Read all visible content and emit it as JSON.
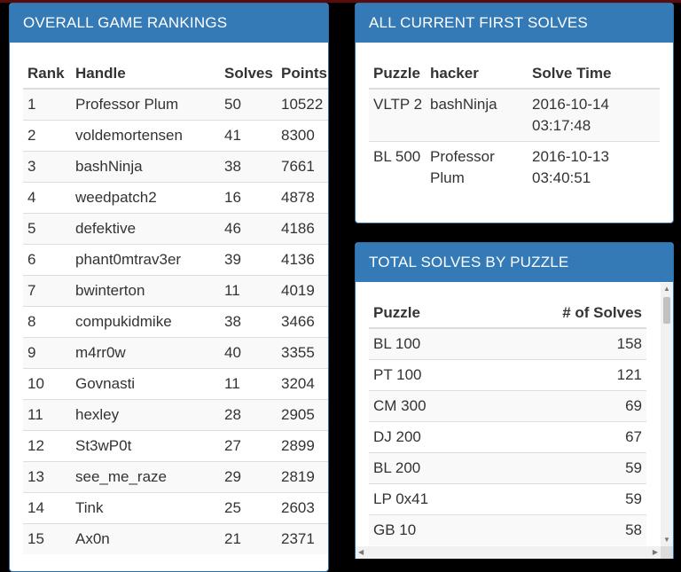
{
  "rankings": {
    "title": "OVERALL GAME RANKINGS",
    "headers": [
      "Rank",
      "Handle",
      "Solves",
      "Points"
    ],
    "rows": [
      [
        "1",
        "Professor Plum",
        "50",
        "10522"
      ],
      [
        "2",
        "voldemortensen",
        "41",
        "8300"
      ],
      [
        "3",
        "bashNinja",
        "38",
        "7661"
      ],
      [
        "4",
        "weedpatch2",
        "16",
        "4878"
      ],
      [
        "5",
        "defektive",
        "46",
        "4186"
      ],
      [
        "6",
        "phant0mtrav3er",
        "39",
        "4136"
      ],
      [
        "7",
        "bwinterton",
        "11",
        "4019"
      ],
      [
        "8",
        "compukidmike",
        "38",
        "3466"
      ],
      [
        "9",
        "m4rr0w",
        "40",
        "3355"
      ],
      [
        "10",
        "Govnasti",
        "11",
        "3204"
      ],
      [
        "11",
        "hexley",
        "28",
        "2905"
      ],
      [
        "12",
        "St3wP0t",
        "27",
        "2899"
      ],
      [
        "13",
        "see_me_raze",
        "29",
        "2819"
      ],
      [
        "14",
        "Tink",
        "25",
        "2603"
      ],
      [
        "15",
        "Ax0n",
        "21",
        "2371"
      ]
    ]
  },
  "first_solves": {
    "title": "ALL CURRENT FIRST SOLVES",
    "headers": [
      "Puzzle",
      "hacker",
      "Solve Time"
    ],
    "rows": [
      [
        "VLTP 2",
        "bashNinja",
        "2016-10-14 03:17:48"
      ],
      [
        "BL 500",
        "Professor Plum",
        "2016-10-13 03:40:51"
      ]
    ]
  },
  "total_solves": {
    "title": "TOTAL SOLVES BY PUZZLE",
    "headers": [
      "Puzzle",
      "# of Solves"
    ],
    "rows": [
      [
        "BL 100",
        "158"
      ],
      [
        "PT 100",
        "121"
      ],
      [
        "CM 300",
        "69"
      ],
      [
        "DJ 200",
        "67"
      ],
      [
        "BL 200",
        "59"
      ],
      [
        "LP 0x41",
        "59"
      ],
      [
        "GB 10",
        "58"
      ]
    ]
  },
  "scrollbar": {
    "up": "▲",
    "down": "▼",
    "left": "◀",
    "right": "▶"
  }
}
